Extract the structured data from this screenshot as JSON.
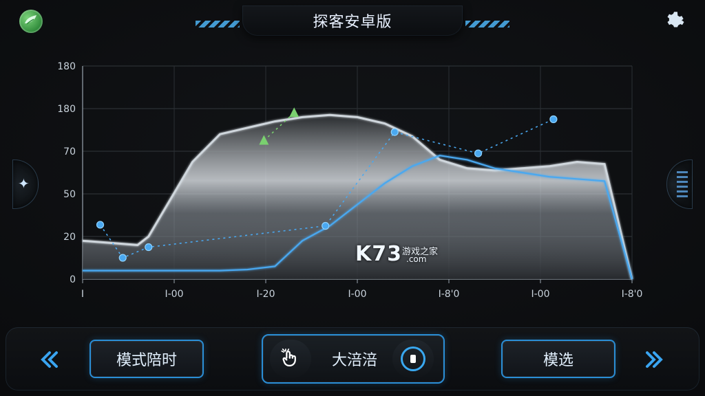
{
  "app": {
    "title": "探客安卓版",
    "logo_icon": "leaf-logo-icon",
    "settings_icon": "gear-icon"
  },
  "chart_data": {
    "type": "area",
    "yticks": [
      "180",
      "180",
      "70",
      "50",
      "20",
      "0"
    ],
    "xticks": [
      "I",
      "I-00",
      "I-20",
      "I-00",
      "I-8'0",
      "I-00",
      "I-8'0"
    ],
    "series": [
      {
        "color": "#cfd6dc",
        "x": [
          0,
          0.05,
          0.1,
          0.12,
          0.2,
          0.25,
          0.35,
          0.4,
          0.45,
          0.5,
          0.55,
          0.6,
          0.65,
          0.7,
          0.75,
          0.8,
          0.85,
          0.9,
          0.95,
          1
        ],
        "values": [
          0.18,
          0.17,
          0.16,
          0.2,
          0.55,
          0.68,
          0.74,
          0.76,
          0.77,
          0.76,
          0.73,
          0.67,
          0.56,
          0.52,
          0.51,
          0.52,
          0.53,
          0.55,
          0.54,
          0
        ]
      },
      {
        "color": "#4aa8f0",
        "x": [
          0,
          0.1,
          0.2,
          0.25,
          0.3,
          0.35,
          0.4,
          0.45,
          0.5,
          0.55,
          0.6,
          0.65,
          0.7,
          0.75,
          0.8,
          0.85,
          0.9,
          0.95,
          1
        ],
        "values": [
          0.04,
          0.04,
          0.04,
          0.04,
          0.045,
          0.06,
          0.18,
          0.25,
          0.35,
          0.45,
          0.53,
          0.58,
          0.56,
          0.52,
          0.5,
          0.48,
          0.47,
          0.46,
          0
        ]
      }
    ],
    "dotted_series": [
      {
        "color": "#4aa8f0",
        "x": [
          0.032,
          0.073,
          0.12,
          0.442,
          0.568,
          0.72,
          0.857
        ],
        "values": [
          0.255,
          0.1,
          0.15,
          0.25,
          0.69,
          0.59,
          0.75
        ]
      },
      {
        "color": "#7ad06f",
        "x": [
          0.33,
          0.385
        ],
        "values": [
          0.65,
          0.78
        ]
      }
    ]
  },
  "watermark": {
    "brand": "K73",
    "text": "游戏之家",
    "domain": ".com"
  },
  "controls": {
    "mode_button": "模式陪时",
    "center_label": "大涪涪",
    "select_button": "模选",
    "prev_icon": "chevron-left-icon",
    "next_icon": "chevron-right-icon",
    "left_icon": "hand-click-icon",
    "right_icon": "record-icon"
  }
}
